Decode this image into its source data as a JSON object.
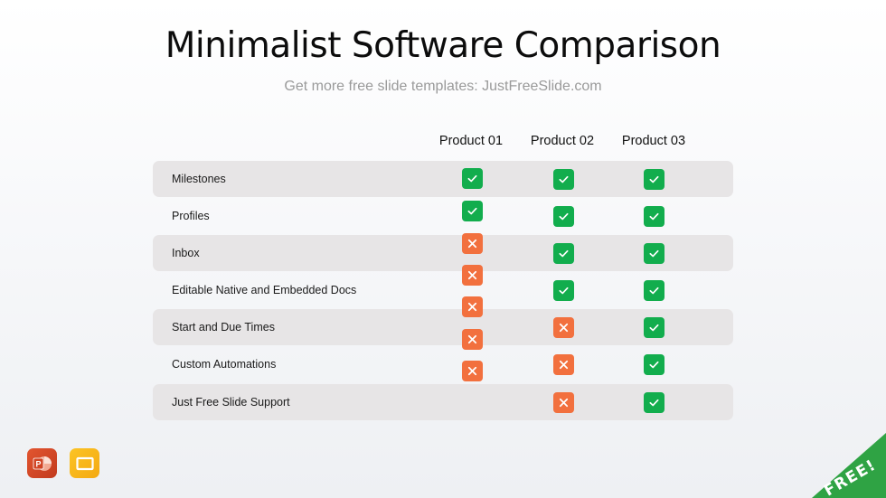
{
  "slide": {
    "title": "Minimalist Software Comparison",
    "subtitle": "Get more free slide templates: JustFreeSlide.com"
  },
  "table": {
    "columns": [
      "Product 01",
      "Product 02",
      "Product 03"
    ],
    "rows": [
      {
        "label": "Milestones",
        "values": [
          true,
          true,
          true
        ]
      },
      {
        "label": "Profiles",
        "values": [
          true,
          true,
          true
        ]
      },
      {
        "label": "Inbox",
        "values": [
          false,
          true,
          true
        ]
      },
      {
        "label": "Editable Native and Embedded Docs",
        "values": [
          false,
          true,
          true
        ]
      },
      {
        "label": "Start and Due Times",
        "values": [
          false,
          false,
          true
        ]
      },
      {
        "label": "Custom Automations",
        "values": [
          false,
          false,
          true
        ]
      },
      {
        "label": "Just Free Slide Support",
        "values": [
          false,
          false,
          true
        ]
      }
    ],
    "yes_icon": "check-icon",
    "no_icon": "x-icon"
  },
  "colors": {
    "yes": "#12ad4d",
    "no": "#f2703e",
    "row_shade": "#e7e5e6",
    "ribbon": "#2fa344"
  },
  "footer": {
    "apps": [
      {
        "name": "powerpoint-icon",
        "glyph": "P"
      },
      {
        "name": "google-slides-icon",
        "glyph": ""
      }
    ],
    "ribbon_label": "FREE!"
  }
}
